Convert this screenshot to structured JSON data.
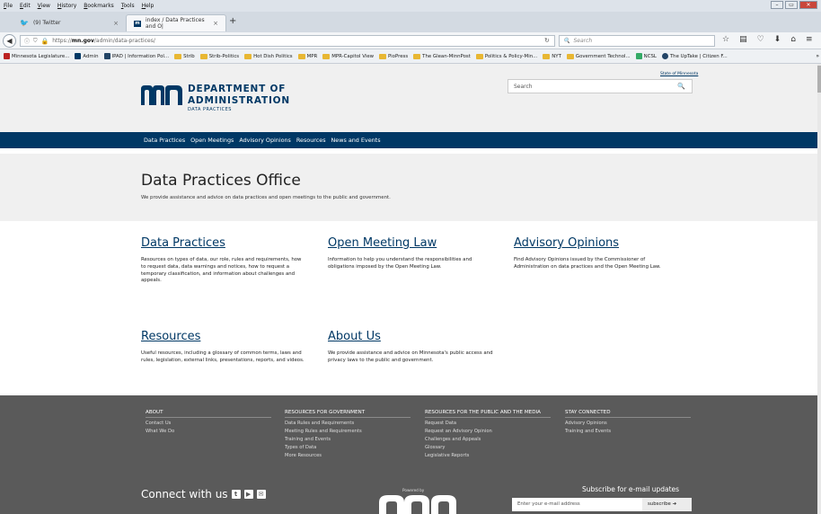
{
  "browser": {
    "menu": [
      "File",
      "Edit",
      "View",
      "History",
      "Bookmarks",
      "Tools",
      "Help"
    ],
    "tabs": [
      {
        "label": "(9) Twitter",
        "close": "×"
      },
      {
        "label": "index / Data Practices and O|",
        "close": "×"
      }
    ],
    "new_tab": "+",
    "url_prefix": "https://",
    "url_domain": "mn.gov",
    "url_path": "/admin/data-practices/",
    "search_placeholder": "Search",
    "bookmarks": [
      "Minnesota Legislature...",
      "Admin",
      "IPAD | Information Pol...",
      "Strib",
      "Strib-Politics",
      "Hot Dish Politics",
      "MPR",
      "MPR-Capitol View",
      "PioPress",
      "The Glean-MinnPost",
      "Politics & Policy-Min...",
      "NYT",
      "Government Technol...",
      "NCSL",
      "The UpTake | Citizen F..."
    ],
    "bookmarks_more": "»"
  },
  "site": {
    "state_link": "State of Minnesota",
    "logo": {
      "line1": "DEPARTMENT OF",
      "line2": "ADMINISTRATION",
      "line3": "DATA PRACTICES"
    },
    "search_placeholder": "Search",
    "nav": [
      "Data Practices",
      "Open Meetings",
      "Advisory Opinions",
      "Resources",
      "News and Events"
    ],
    "hero": {
      "title": "Data Practices Office",
      "subtitle": "We provide assistance and advice on data practices and open meetings to the public and government."
    },
    "cards": [
      {
        "title": "Data Practices",
        "desc": "Resources on types of data, our role, rules and requirements, how to request data, data warnings and notices, how to request a temporary classification, and information about challenges and appeals."
      },
      {
        "title": "Open Meeting Law",
        "desc": "Information to help you understand the responsibilities and obligations imposed by the Open Meeting Law."
      },
      {
        "title": "Advisory Opinions",
        "desc": "Find Advisory Opinions issued by the Commissioner of Administration on data practices and the Open Meeting Law."
      },
      {
        "title": "Resources",
        "desc": "Useful resources, including a glossary of common terms, laws and rules, legislation, external links, presentations, reports, and videos."
      },
      {
        "title": "About Us",
        "desc": "We provide assistance and advice on Minnesota's public access and privacy laws to the public and government."
      }
    ],
    "footer": {
      "columns": [
        {
          "heading": "ABOUT",
          "items": [
            "Contact Us",
            "What We Do"
          ]
        },
        {
          "heading": "RESOURCES FOR GOVERNMENT",
          "items": [
            "Data Rules and Requirements",
            "Meeting Rules and Requirements",
            "Training and Events",
            "Types of Data",
            "More Resources"
          ]
        },
        {
          "heading": "RESOURCES FOR THE PUBLIC AND THE MEDIA",
          "items": [
            "Request Data",
            "Request an Advisory Opinion",
            "Challenges and Appeals",
            "Glossary",
            "Legislative Reports"
          ]
        },
        {
          "heading": "STAY CONNECTED",
          "items": [
            "Advisory Opinions",
            "Training and Events"
          ]
        }
      ],
      "connect_label": "Connect with us",
      "powered_by": "Powered by",
      "subscribe_title": "Subscribe for e-mail updates",
      "email_placeholder": "Enter your e-mail address",
      "subscribe_button": "subscribe"
    }
  },
  "colors": {
    "brand_navy": "#003865",
    "footer_gray": "#5a5a5a",
    "header_gray": "#f0f0f0"
  }
}
